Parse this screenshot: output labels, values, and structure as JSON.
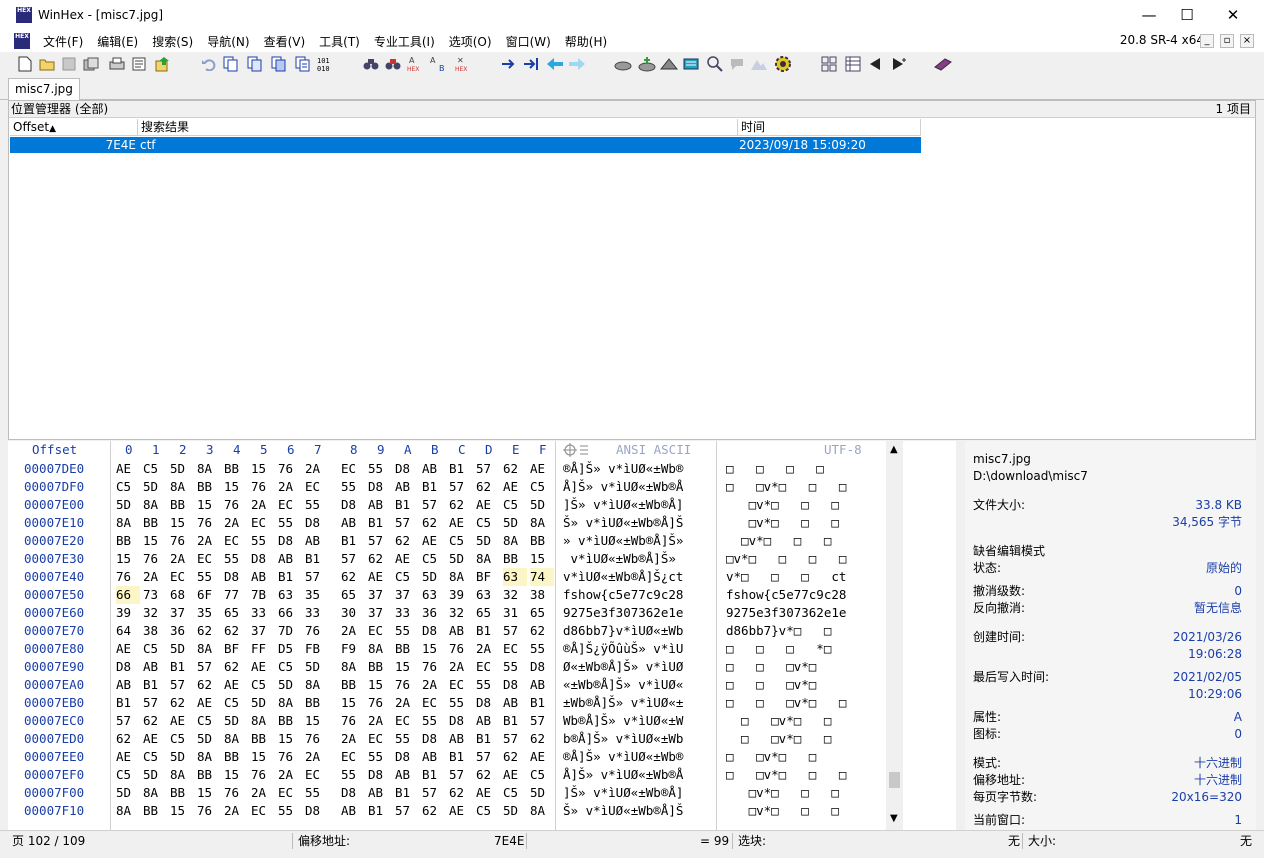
{
  "window": {
    "title": "WinHex - [misc7.jpg]",
    "logo": "HEX",
    "min": "—",
    "max": "☐",
    "close": "✕"
  },
  "menu": {
    "items": [
      "文件(F)",
      "编辑(E)",
      "搜索(S)",
      "导航(N)",
      "查看(V)",
      "工具(T)",
      "专业工具(I)",
      "选项(O)",
      "窗口(W)",
      "帮助(H)"
    ],
    "version": "20.8 SR-4 x64",
    "mdi_min": "_",
    "mdi_restore": "▫",
    "mdi_close": "×"
  },
  "toolbar": {
    "icons": [
      "new-file-icon",
      "open-file-icon",
      "save-icon",
      "save-all-icon",
      "print-icon",
      "properties-icon",
      "export-icon",
      "undo-icon",
      "copy-icon",
      "cut-icon",
      "paste-icon",
      "paste-write-icon",
      "copy-hex-icon",
      "find-text-icon",
      "find-hex-icon",
      "replace-text-icon",
      "replace-hex-icon",
      "goto-offset-icon",
      "goto-position-icon",
      "back-icon",
      "forward-icon",
      "open-disk-icon",
      "open-ram-icon",
      "ram-editor-icon",
      "calculator-icon",
      "hash-icon",
      "dlg-icon",
      "disk-image-icon",
      "refresh-icon",
      "options-icon",
      "tile-windows-icon",
      "prev-window-icon",
      "next-window-icon",
      "help-book-icon"
    ]
  },
  "tab": {
    "label": "misc7.jpg"
  },
  "position_manager": {
    "header": "位置管理器 (全部)",
    "count": "1 项目",
    "columns": {
      "offset": "Offset",
      "result": "搜索结果",
      "time": "时间"
    },
    "sort_arrow": "▲",
    "rows": [
      {
        "offset": "7E4E",
        "result": "ctf",
        "time": "2023/09/18  15:09:20"
      }
    ]
  },
  "hex": {
    "header_offset": "Offset",
    "columns": [
      "0",
      "1",
      "2",
      "3",
      "4",
      "5",
      "6",
      "7",
      "8",
      "9",
      "A",
      "B",
      "C",
      "D",
      "E",
      "F"
    ],
    "ansi_label": "ANSI ASCII",
    "utf8_label": "UTF-8",
    "rows": [
      {
        "offset": "00007DE0",
        "bytes": [
          "AE",
          "C5",
          "5D",
          "8A",
          "BB",
          "15",
          "76",
          "2A",
          "EC",
          "55",
          "D8",
          "AB",
          "B1",
          "57",
          "62",
          "AE"
        ],
        "ansi": "®Å]Š» v*ìUØ«±Wb®",
        "utf8": "□   □   □   □"
      },
      {
        "offset": "00007DF0",
        "bytes": [
          "C5",
          "5D",
          "8A",
          "BB",
          "15",
          "76",
          "2A",
          "EC",
          "55",
          "D8",
          "AB",
          "B1",
          "57",
          "62",
          "AE",
          "C5"
        ],
        "ansi": "Å]Š» v*ìUØ«±Wb®Å",
        "utf8": "□   □v*□   □   □"
      },
      {
        "offset": "00007E00",
        "bytes": [
          "5D",
          "8A",
          "BB",
          "15",
          "76",
          "2A",
          "EC",
          "55",
          "D8",
          "AB",
          "B1",
          "57",
          "62",
          "AE",
          "C5",
          "5D"
        ],
        "ansi": "]Š» v*ìUØ«±Wb®Å]",
        "utf8": "   □v*□   □   □"
      },
      {
        "offset": "00007E10",
        "bytes": [
          "8A",
          "BB",
          "15",
          "76",
          "2A",
          "EC",
          "55",
          "D8",
          "AB",
          "B1",
          "57",
          "62",
          "AE",
          "C5",
          "5D",
          "8A"
        ],
        "ansi": "Š» v*ìUØ«±Wb®Å]Š",
        "utf8": "   □v*□   □   □"
      },
      {
        "offset": "00007E20",
        "bytes": [
          "BB",
          "15",
          "76",
          "2A",
          "EC",
          "55",
          "D8",
          "AB",
          "B1",
          "57",
          "62",
          "AE",
          "C5",
          "5D",
          "8A",
          "BB"
        ],
        "ansi": "» v*ìUØ«±Wb®Å]Š»",
        "utf8": "  □v*□   □   □"
      },
      {
        "offset": "00007E30",
        "bytes": [
          "15",
          "76",
          "2A",
          "EC",
          "55",
          "D8",
          "AB",
          "B1",
          "57",
          "62",
          "AE",
          "C5",
          "5D",
          "8A",
          "BB",
          "15"
        ],
        "ansi": " v*ìUØ«±Wb®Å]Š» ",
        "utf8": "□v*□   □   □   □"
      },
      {
        "offset": "00007E40",
        "bytes": [
          "76",
          "2A",
          "EC",
          "55",
          "D8",
          "AB",
          "B1",
          "57",
          "62",
          "AE",
          "C5",
          "5D",
          "8A",
          "BF",
          "63",
          "74"
        ],
        "ansi": "v*ìUØ«±Wb®Å]Š¿ct",
        "utf8": "v*□   □   □   ct"
      },
      {
        "offset": "00007E50",
        "bytes": [
          "66",
          "73",
          "68",
          "6F",
          "77",
          "7B",
          "63",
          "35",
          "65",
          "37",
          "37",
          "63",
          "39",
          "63",
          "32",
          "38"
        ],
        "ansi": "fshow{c5e77c9c28",
        "utf8": "fshow{c5e77c9c28"
      },
      {
        "offset": "00007E60",
        "bytes": [
          "39",
          "32",
          "37",
          "35",
          "65",
          "33",
          "66",
          "33",
          "30",
          "37",
          "33",
          "36",
          "32",
          "65",
          "31",
          "65"
        ],
        "ansi": "9275e3f307362e1e",
        "utf8": "9275e3f307362e1e"
      },
      {
        "offset": "00007E70",
        "bytes": [
          "64",
          "38",
          "36",
          "62",
          "62",
          "37",
          "7D",
          "76",
          "2A",
          "EC",
          "55",
          "D8",
          "AB",
          "B1",
          "57",
          "62"
        ],
        "ansi": "d86bb7}v*ìUØ«±Wb",
        "utf8": "d86bb7}v*□   □"
      },
      {
        "offset": "00007E80",
        "bytes": [
          "AE",
          "C5",
          "5D",
          "8A",
          "BF",
          "FF",
          "D5",
          "FB",
          "F9",
          "8A",
          "BB",
          "15",
          "76",
          "2A",
          "EC",
          "55"
        ],
        "ansi": "®Å]Š¿ÿÕûùŠ» v*ìU",
        "utf8": "□   □   □   *□"
      },
      {
        "offset": "00007E90",
        "bytes": [
          "D8",
          "AB",
          "B1",
          "57",
          "62",
          "AE",
          "C5",
          "5D",
          "8A",
          "BB",
          "15",
          "76",
          "2A",
          "EC",
          "55",
          "D8"
        ],
        "ansi": "Ø«±Wb®Å]Š» v*ìUØ",
        "utf8": "□   □   □v*□"
      },
      {
        "offset": "00007EA0",
        "bytes": [
          "AB",
          "B1",
          "57",
          "62",
          "AE",
          "C5",
          "5D",
          "8A",
          "BB",
          "15",
          "76",
          "2A",
          "EC",
          "55",
          "D8",
          "AB"
        ],
        "ansi": "«±Wb®Å]Š» v*ìUØ«",
        "utf8": "□   □   □v*□"
      },
      {
        "offset": "00007EB0",
        "bytes": [
          "B1",
          "57",
          "62",
          "AE",
          "C5",
          "5D",
          "8A",
          "BB",
          "15",
          "76",
          "2A",
          "EC",
          "55",
          "D8",
          "AB",
          "B1"
        ],
        "ansi": "±Wb®Å]Š» v*ìUØ«±",
        "utf8": "□   □   □v*□   □"
      },
      {
        "offset": "00007EC0",
        "bytes": [
          "57",
          "62",
          "AE",
          "C5",
          "5D",
          "8A",
          "BB",
          "15",
          "76",
          "2A",
          "EC",
          "55",
          "D8",
          "AB",
          "B1",
          "57"
        ],
        "ansi": "Wb®Å]Š» v*ìUØ«±W",
        "utf8": "  □   □v*□   □"
      },
      {
        "offset": "00007ED0",
        "bytes": [
          "62",
          "AE",
          "C5",
          "5D",
          "8A",
          "BB",
          "15",
          "76",
          "2A",
          "EC",
          "55",
          "D8",
          "AB",
          "B1",
          "57",
          "62"
        ],
        "ansi": "b®Å]Š» v*ìUØ«±Wb",
        "utf8": "  □   □v*□   □"
      },
      {
        "offset": "00007EE0",
        "bytes": [
          "AE",
          "C5",
          "5D",
          "8A",
          "BB",
          "15",
          "76",
          "2A",
          "EC",
          "55",
          "D8",
          "AB",
          "B1",
          "57",
          "62",
          "AE"
        ],
        "ansi": "®Å]Š» v*ìUØ«±Wb®",
        "utf8": "□   □v*□   □"
      },
      {
        "offset": "00007EF0",
        "bytes": [
          "C5",
          "5D",
          "8A",
          "BB",
          "15",
          "76",
          "2A",
          "EC",
          "55",
          "D8",
          "AB",
          "B1",
          "57",
          "62",
          "AE",
          "C5"
        ],
        "ansi": "Å]Š» v*ìUØ«±Wb®Å",
        "utf8": "□   □v*□   □   □"
      },
      {
        "offset": "00007F00",
        "bytes": [
          "5D",
          "8A",
          "BB",
          "15",
          "76",
          "2A",
          "EC",
          "55",
          "D8",
          "AB",
          "B1",
          "57",
          "62",
          "AE",
          "C5",
          "5D"
        ],
        "ansi": "]Š» v*ìUØ«±Wb®Å]",
        "utf8": "   □v*□   □   □"
      },
      {
        "offset": "00007F10",
        "bytes": [
          "8A",
          "BB",
          "15",
          "76",
          "2A",
          "EC",
          "55",
          "D8",
          "AB",
          "B1",
          "57",
          "62",
          "AE",
          "C5",
          "5D",
          "8A"
        ],
        "ansi": "Š» v*ìUØ«±Wb®Å]Š",
        "utf8": "   □v*□   □   □"
      }
    ]
  },
  "info": {
    "filename": "misc7.jpg",
    "path": "D:\\download\\misc7",
    "size_label": "文件大小:",
    "size_kb": "33.8 KB",
    "size_bytes": "34,565 字节",
    "edit_mode": "缺省编辑模式",
    "state_label": "状态:",
    "state_value": "原始的",
    "undo_label": "撤消级数:",
    "undo_value": "0",
    "redo_label": "反向撤消:",
    "redo_value": "暂无信息",
    "created_label": "创建时间:",
    "created_date": "2021/03/26",
    "created_time": "19:06:28",
    "modified_label": "最后写入时间:",
    "modified_date": "2021/02/05",
    "modified_time": "10:29:06",
    "attr_label": "属性:",
    "attr_value": "A",
    "icon_label": "图标:",
    "icon_value": "0",
    "mode_label": "模式:",
    "mode_value": "十六进制",
    "offset_label": "偏移地址:",
    "offset_value": "十六进制",
    "bpp_label": "每页字节数:",
    "bpp_value": "20x16=320",
    "window_label": "当前窗口:",
    "window_value": "1"
  },
  "status": {
    "page": "页 102 / 109",
    "offset_label": "偏移地址:",
    "offset_value": "7E4E",
    "eq": "= 99",
    "block_label": "选块:",
    "block_value": "无",
    "size_label": "大小:",
    "size_value": "无"
  },
  "colors": {
    "selection": "#0078d7",
    "hex_blue": "#1a3ea8",
    "highlight": "#fcf6c6"
  }
}
